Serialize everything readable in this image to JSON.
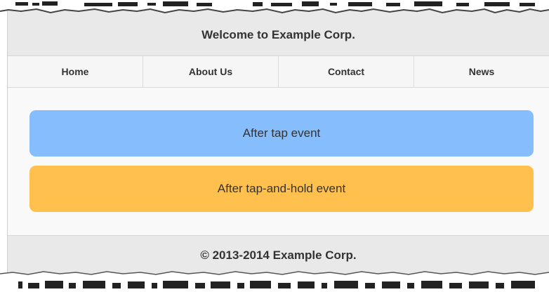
{
  "header": {
    "title": "Welcome to Example Corp."
  },
  "navbar": {
    "items": [
      {
        "label": "Home"
      },
      {
        "label": "About Us"
      },
      {
        "label": "Contact"
      },
      {
        "label": "News"
      }
    ]
  },
  "events": {
    "tap_label": "After tap event",
    "hold_label": "After tap-and-hold event",
    "tap_color": "#85bdfd",
    "hold_color": "#ffc04e"
  },
  "footer": {
    "text": "© 2013-2014 Example Corp."
  }
}
